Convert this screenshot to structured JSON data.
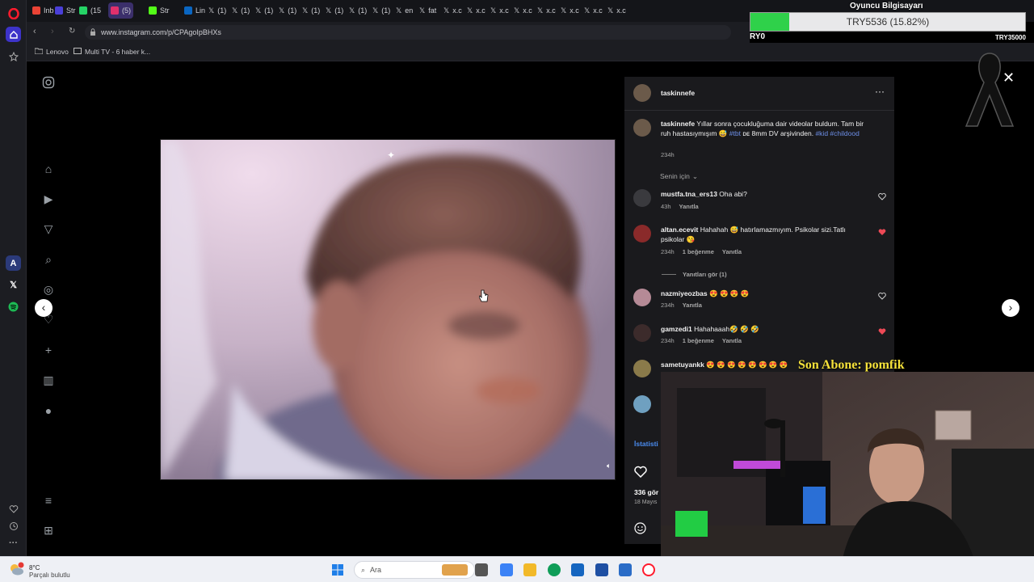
{
  "browser": {
    "tabs": [
      "Inb",
      "Str",
      "(15",
      "(5)",
      "Str",
      "Lin",
      "(1)",
      "(1)",
      "(1)",
      "(1)",
      "(1)",
      "(1)",
      "(1)",
      "(1)",
      "en",
      "fat",
      "x.c",
      "x.c",
      "x.c",
      "x.c",
      "x.c",
      "x.c",
      "x.c",
      "x.c"
    ],
    "url": "www.instagram.com/p/CPAgoIpBHXs",
    "bookmarks": [
      "Lenovo",
      "Multi TV - 6 haber k..."
    ]
  },
  "crypto_widget": {
    "title": "Oyuncu Bilgisayarı",
    "ticker": "TRY5536 (15.82%)",
    "left_label": "RY0",
    "right_label": "TRY35000",
    "progress": 0.14,
    "accent": "#2fd14a"
  },
  "post": {
    "username": "taskinnefe",
    "caption_prefix": "Yıllar sonra çocukluğuma dair videolar buldum. Tam bir ruh hastasıymışım 😅",
    "caption_tag1": "#tbt",
    "caption_mid": "ᴅᴇ 8mm DV arşivinden.",
    "caption_tag2": "#kid",
    "caption_tag3": "#childood",
    "caption_time": "234h",
    "filter_label": "Senin için",
    "stats_label": "İstatisti",
    "views": "336 gör",
    "date": "18 Mayıs"
  },
  "comments": [
    {
      "user": "mustfa.tna_ers13",
      "text": "Oha abi?",
      "time": "43h",
      "likes": "",
      "reply": "Yanıtla",
      "liked": false
    },
    {
      "user": "altan.ecevit",
      "text": "Hahahah 😅 hatırlamazmıyım. Psikolar sizi.Tatlı psikolar 😘",
      "time": "234h",
      "likes": "1 beğenme",
      "reply": "Yanıtla",
      "liked": true
    },
    {
      "user": "nazmiyeozbas",
      "text": "😍 😍 😍 😍",
      "time": "234h",
      "likes": "",
      "reply": "Yanıtla",
      "liked": false
    },
    {
      "user": "gamzedi1",
      "text": "Hahahaaah🤣 🤣 🤣",
      "time": "234h",
      "likes": "1 beğenme",
      "reply": "Yanıtla",
      "liked": true
    },
    {
      "user": "sametuyankk",
      "text": "😍 😍 😍 😍 😍 😍 😍 😍",
      "time": "",
      "likes": "",
      "reply": "",
      "liked": false
    }
  ],
  "view_replies": "Yanıtları gör (1)",
  "overlay": {
    "sub_label": "Son Abone: pomfik"
  },
  "taskbar": {
    "weather_temp": "8°C",
    "weather_desc": "Parçalı bulutlu",
    "search_placeholder": "Ara"
  },
  "colors": {
    "ig_bg": "#000000",
    "panel": "#1a1a1d",
    "link": "#6d8fe8",
    "liked_heart": "#ed4956",
    "opera_red": "#ff1b2d"
  }
}
